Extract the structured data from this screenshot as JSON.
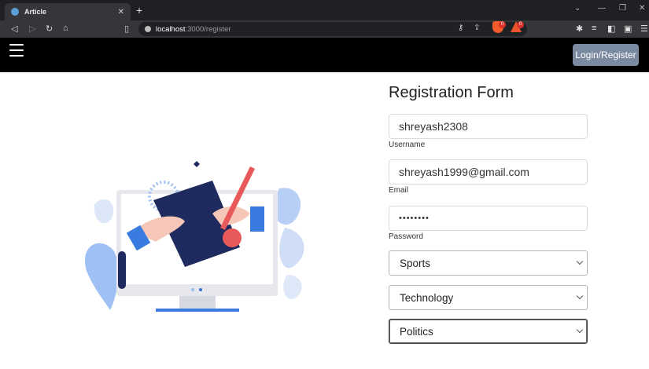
{
  "browser": {
    "tab_title": "Article",
    "url_host": "localhost",
    "url_path": ":3000/register",
    "shields_count": "0",
    "rewards_count": "0"
  },
  "navbar": {
    "login_register_label": "Login/Register"
  },
  "form": {
    "title": "Registration Form",
    "username_value": "shreyash2308",
    "username_label": "Username",
    "email_value": "shreyash1999@gmail.com",
    "email_label": "Email",
    "password_value": "••••••••",
    "password_label": "Password",
    "selects": [
      {
        "value": "Sports"
      },
      {
        "value": "Technology"
      },
      {
        "value": "Politics"
      }
    ]
  },
  "icons": {
    "menu": "hamburger-menu-icon",
    "tab_favicon": "globe-icon"
  }
}
